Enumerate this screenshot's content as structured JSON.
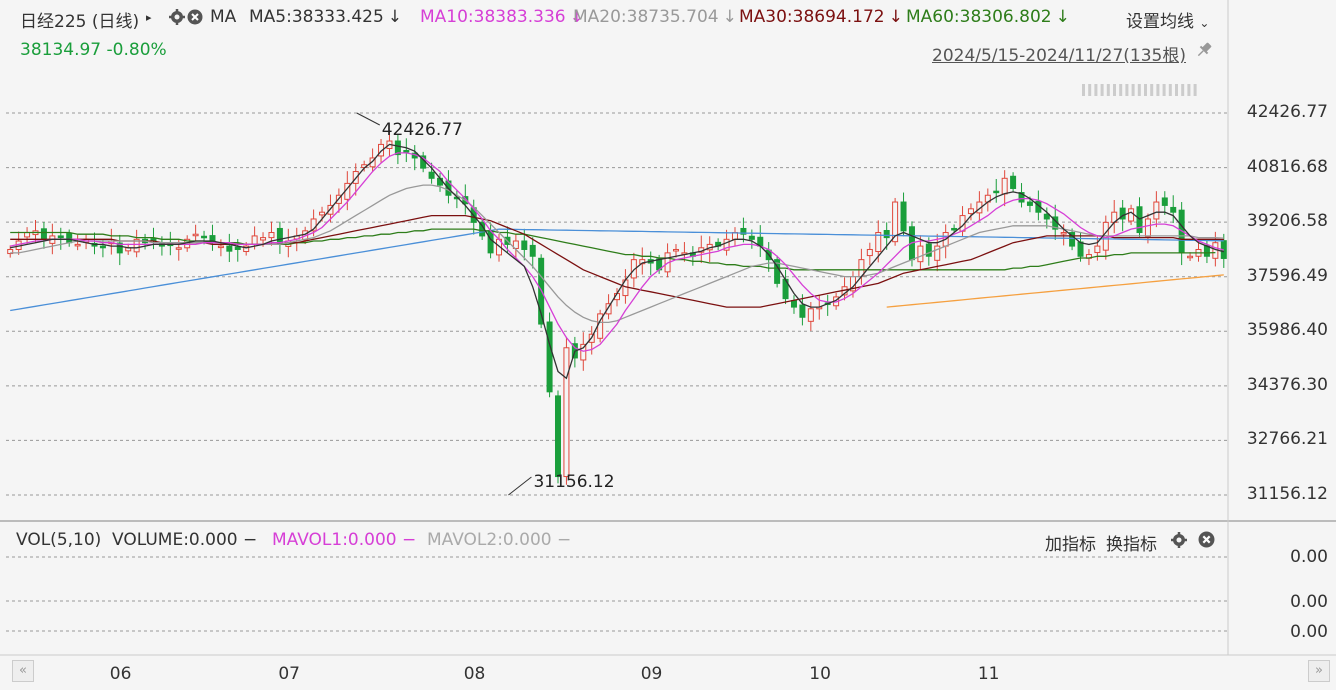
{
  "header": {
    "instrument": "日经225 (日线)",
    "play_glyph": "▸",
    "ma_label": "MA",
    "ma5": "MA5:38333.425",
    "ma10": "MA10:38383.336",
    "ma20": "MA20:38735.704",
    "ma30": "MA30:38694.172",
    "ma60": "MA60:38306.802",
    "down_arrow": "↓",
    "settings": "设置均线",
    "chevron": "⌄",
    "price": "38134.97",
    "change": "-0.80%",
    "range": "2024/5/15-2024/11/27(135根)"
  },
  "colors": {
    "up": "#e0473b",
    "down": "#1a9e3b",
    "ma5": "#333333",
    "ma10": "#d63fd6",
    "ma20": "#999999",
    "ma30": "#7b1010",
    "ma60": "#2e7d1a",
    "ma_long": "#4a8fd8",
    "ma_orange": "#f5a040"
  },
  "chart_data": {
    "type": "candlestick",
    "date_range": [
      "2024-05-15",
      "2024-11-27"
    ],
    "bar_count": 135,
    "ylim": [
      31156.12,
      42426.77
    ],
    "y_ticks": [
      "42426.77",
      "40816.68",
      "39206.58",
      "37596.49",
      "35986.40",
      "34376.30",
      "32766.21",
      "31156.12"
    ],
    "x_ticks": [
      "06",
      "07",
      "08",
      "09",
      "10",
      "11"
    ],
    "x_tick_index": [
      13,
      33,
      55,
      76,
      96,
      116
    ],
    "annotations": [
      {
        "label": "42426.77",
        "index": 41,
        "value": 42426.77
      },
      {
        "label": "31156.12",
        "index": 59,
        "value": 31156.12
      }
    ],
    "close": [
      38400,
      38650,
      38900,
      38950,
      38700,
      38800,
      38750,
      38600,
      38550,
      38700,
      38500,
      38450,
      38650,
      38300,
      38450,
      38700,
      38600,
      38650,
      38500,
      38550,
      38450,
      38700,
      38850,
      38750,
      38600,
      38500,
      38350,
      38400,
      38500,
      38800,
      38750,
      38900,
      38550,
      38650,
      38800,
      38950,
      39300,
      39500,
      39700,
      40000,
      40350,
      40700,
      40900,
      41100,
      41500,
      41600,
      41200,
      41300,
      41100,
      40800,
      40500,
      40300,
      40000,
      39900,
      39750,
      39200,
      38800,
      38300,
      38700,
      38550,
      38650,
      38400,
      38200,
      36200,
      34200,
      31700,
      35500,
      35200,
      35600,
      35900,
      36500,
      36800,
      37100,
      37500,
      38100,
      38100,
      38000,
      37800,
      38300,
      38400,
      38300,
      38200,
      38450,
      38550,
      38500,
      38700,
      38900,
      38850,
      38700,
      38500,
      38100,
      37400,
      36950,
      36700,
      36400,
      36650,
      36700,
      36800,
      37000,
      37300,
      37600,
      38100,
      38400,
      38900,
      38750,
      39800,
      38950,
      38100,
      38500,
      38200,
      38500,
      38900,
      39000,
      39400,
      39600,
      39800,
      40000,
      40100,
      40500,
      40200,
      39800,
      39700,
      39500,
      39300,
      39000,
      38900,
      38500,
      38200,
      38250,
      38500,
      39200,
      39500,
      39300,
      39600,
      38900,
      39300,
      39800,
      39700,
      39500,
      38300,
      38200,
      38400,
      38200,
      38600,
      38134.97
    ],
    "ma5": [
      38450,
      38500,
      38550,
      38600,
      38650,
      38700,
      38700,
      38700,
      38650,
      38600,
      38550,
      38550,
      38500,
      38500,
      38450,
      38450,
      38500,
      38550,
      38550,
      38550,
      38550,
      38600,
      38650,
      38650,
      38650,
      38600,
      38550,
      38500,
      38450,
      38500,
      38550,
      38650,
      38700,
      38750,
      38800,
      38850,
      39000,
      39300,
      39600,
      39900,
      40200,
      40500,
      40800,
      41000,
      41300,
      41500,
      41450,
      41400,
      41300,
      41050,
      40800,
      40500,
      40200,
      39950,
      39700,
      39400,
      39100,
      38700,
      38500,
      38300,
      38100,
      37900,
      37300,
      36500,
      35600,
      34800,
      34600,
      35400,
      35500,
      35800,
      36300,
      36700,
      37100,
      37500,
      37800,
      38000,
      38050,
      38100,
      38150,
      38200,
      38250,
      38300,
      38350,
      38450,
      38500,
      38600,
      38700,
      38700,
      38650,
      38500,
      38250,
      37900,
      37500,
      37100,
      36800,
      36700,
      36700,
      36800,
      36900,
      37100,
      37300,
      37600,
      37900,
      38200,
      38500,
      38800,
      38900,
      38800,
      38700,
      38600,
      38600,
      38700,
      38900,
      39100,
      39400,
      39600,
      39800,
      39950,
      40050,
      40100,
      40050,
      39900,
      39700,
      39500,
      39250,
      39000,
      38800,
      38600,
      38550,
      38600,
      38900,
      39200,
      39400,
      39500,
      39300,
      39400,
      39500,
      39500,
      39400,
      39100,
      38800,
      38600,
      38500,
      38400,
      38333.425
    ],
    "ma10": [
      38500,
      38550,
      38600,
      38650,
      38650,
      38700,
      38700,
      38700,
      38700,
      38650,
      38650,
      38600,
      38600,
      38550,
      38550,
      38550,
      38550,
      38550,
      38550,
      38550,
      38550,
      38550,
      38550,
      38600,
      38600,
      38600,
      38600,
      38550,
      38550,
      38550,
      38550,
      38600,
      38600,
      38650,
      38700,
      38800,
      38900,
      39050,
      39300,
      39550,
      39800,
      40100,
      40400,
      40700,
      40950,
      41150,
      41250,
      41250,
      41200,
      41100,
      40900,
      40700,
      40400,
      40150,
      39900,
      39600,
      39300,
      38950,
      38700,
      38400,
      38150,
      37900,
      37600,
      37200,
      36700,
      36200,
      35800,
      35500,
      35400,
      35450,
      35600,
      35900,
      36200,
      36600,
      36950,
      37300,
      37600,
      37800,
      38000,
      38100,
      38150,
      38200,
      38250,
      38300,
      38350,
      38450,
      38500,
      38550,
      38550,
      38500,
      38400,
      38200,
      37950,
      37650,
      37350,
      37100,
      36900,
      36850,
      36850,
      36950,
      37100,
      37300,
      37500,
      37700,
      37950,
      38200,
      38450,
      38600,
      38650,
      38650,
      38700,
      38750,
      38850,
      38950,
      39100,
      39250,
      39400,
      39600,
      39750,
      39850,
      39900,
      39900,
      39850,
      39750,
      39600,
      39450,
      39250,
      39050,
      38900,
      38800,
      38750,
      38800,
      38900,
      39000,
      39050,
      39100,
      39150,
      39150,
      39100,
      38950,
      38800,
      38650,
      38550,
      38450,
      38383.336
    ],
    "ma20": [
      38300,
      38300,
      38350,
      38400,
      38450,
      38500,
      38550,
      38600,
      38650,
      38650,
      38650,
      38650,
      38650,
      38650,
      38650,
      38650,
      38650,
      38600,
      38600,
      38600,
      38600,
      38600,
      38600,
      38600,
      38600,
      38600,
      38600,
      38550,
      38550,
      38550,
      38550,
      38550,
      38550,
      38600,
      38650,
      38700,
      38750,
      38850,
      38950,
      39100,
      39250,
      39400,
      39550,
      39700,
      39850,
      40000,
      40100,
      40200,
      40250,
      40300,
      40300,
      40250,
      40150,
      40000,
      39850,
      39650,
      39400,
      39150,
      38900,
      38650,
      38400,
      38150,
      37900,
      37600,
      37300,
      37000,
      36750,
      36550,
      36400,
      36300,
      36250,
      36250,
      36300,
      36400,
      36500,
      36600,
      36700,
      36800,
      36900,
      37000,
      37100,
      37200,
      37300,
      37400,
      37500,
      37600,
      37700,
      37800,
      37900,
      37950,
      38000,
      38000,
      37950,
      37900,
      37850,
      37800,
      37750,
      37700,
      37650,
      37600,
      37600,
      37600,
      37650,
      37700,
      37800,
      37900,
      38000,
      38100,
      38200,
      38300,
      38400,
      38500,
      38600,
      38700,
      38800,
      38900,
      38950,
      39000,
      39050,
      39100,
      39100,
      39100,
      39100,
      39100,
      39050,
      39000,
      38950,
      38900,
      38850,
      38800,
      38800,
      38800,
      38800,
      38800,
      38800,
      38800,
      38800,
      38800,
      38800,
      38800,
      38800,
      38750,
      38750,
      38750,
      38735.704
    ],
    "ma30": [
      38700,
      38700,
      38700,
      38700,
      38700,
      38700,
      38700,
      38700,
      38700,
      38700,
      38700,
      38700,
      38700,
      38650,
      38650,
      38650,
      38650,
      38650,
      38600,
      38600,
      38600,
      38600,
      38600,
      38600,
      38550,
      38550,
      38550,
      38550,
      38550,
      38550,
      38550,
      38550,
      38550,
      38600,
      38600,
      38650,
      38700,
      38750,
      38800,
      38850,
      38900,
      38950,
      39000,
      39050,
      39100,
      39150,
      39200,
      39250,
      39300,
      39350,
      39400,
      39400,
      39400,
      39400,
      39400,
      39350,
      39300,
      39250,
      39150,
      39050,
      38950,
      38850,
      38700,
      38550,
      38400,
      38250,
      38100,
      37950,
      37800,
      37700,
      37600,
      37500,
      37400,
      37300,
      37250,
      37200,
      37150,
      37100,
      37050,
      37000,
      36950,
      36900,
      36850,
      36800,
      36750,
      36700,
      36700,
      36700,
      36700,
      36700,
      36750,
      36800,
      36850,
      36900,
      36950,
      37000,
      37050,
      37100,
      37150,
      37200,
      37250,
      37300,
      37350,
      37400,
      37500,
      37600,
      37700,
      37750,
      37800,
      37850,
      37900,
      37950,
      38000,
      38050,
      38100,
      38200,
      38300,
      38400,
      38500,
      38600,
      38650,
      38700,
      38750,
      38800,
      38800,
      38800,
      38800,
      38800,
      38800,
      38800,
      38800,
      38750,
      38750,
      38750,
      38750,
      38750,
      38750,
      38750,
      38750,
      38700,
      38700,
      38700,
      38700,
      38700,
      38694.172
    ],
    "ma60": [
      38900,
      38900,
      38900,
      38900,
      38900,
      38900,
      38900,
      38900,
      38850,
      38850,
      38850,
      38850,
      38800,
      38800,
      38800,
      38750,
      38750,
      38750,
      38700,
      38700,
      38700,
      38650,
      38650,
      38650,
      38600,
      38600,
      38600,
      38600,
      38550,
      38550,
      38550,
      38550,
      38550,
      38550,
      38600,
      38600,
      38650,
      38650,
      38700,
      38700,
      38750,
      38750,
      38800,
      38800,
      38850,
      38850,
      38900,
      38900,
      38950,
      38950,
      39000,
      39000,
      39000,
      39000,
      39000,
      39000,
      38950,
      38950,
      38900,
      38900,
      38850,
      38850,
      38800,
      38750,
      38700,
      38650,
      38600,
      38550,
      38500,
      38450,
      38400,
      38350,
      38300,
      38250,
      38250,
      38200,
      38200,
      38150,
      38150,
      38100,
      38100,
      38050,
      38050,
      38000,
      38000,
      37950,
      37950,
      37900,
      37900,
      37900,
      37850,
      37850,
      37850,
      37800,
      37800,
      37800,
      37800,
      37800,
      37800,
      37800,
      37800,
      37800,
      37800,
      37800,
      37800,
      37800,
      37800,
      37800,
      37800,
      37800,
      37800,
      37800,
      37800,
      37800,
      37800,
      37800,
      37800,
      37800,
      37800,
      37850,
      37850,
      37900,
      37900,
      37950,
      38000,
      38050,
      38100,
      38150,
      38150,
      38200,
      38200,
      38250,
      38250,
      38300,
      38300,
      38300,
      38300,
      38300,
      38300,
      38300,
      38300,
      38300,
      38300,
      38306.802
    ],
    "ma_long": {
      "from_index": 0,
      "values_start": 36600,
      "values_peak_index": 58,
      "values_peak": 39000
    },
    "ma_orange": {
      "from_index": 104,
      "start": 36700,
      "end": 37650
    }
  },
  "volume_panel": {
    "vol_label": "VOL(5,10)",
    "volume": "VOLUME:0.000",
    "mavol1": "MAVOL1:0.000",
    "mavol2": "MAVOL2:0.000",
    "dash": "−",
    "add_indicator": "加指标",
    "switch_indicator": "换指标",
    "y_ticks": [
      "0.00",
      "0.00",
      "0.00"
    ]
  },
  "scroll": {
    "left": "«",
    "right": "»"
  }
}
